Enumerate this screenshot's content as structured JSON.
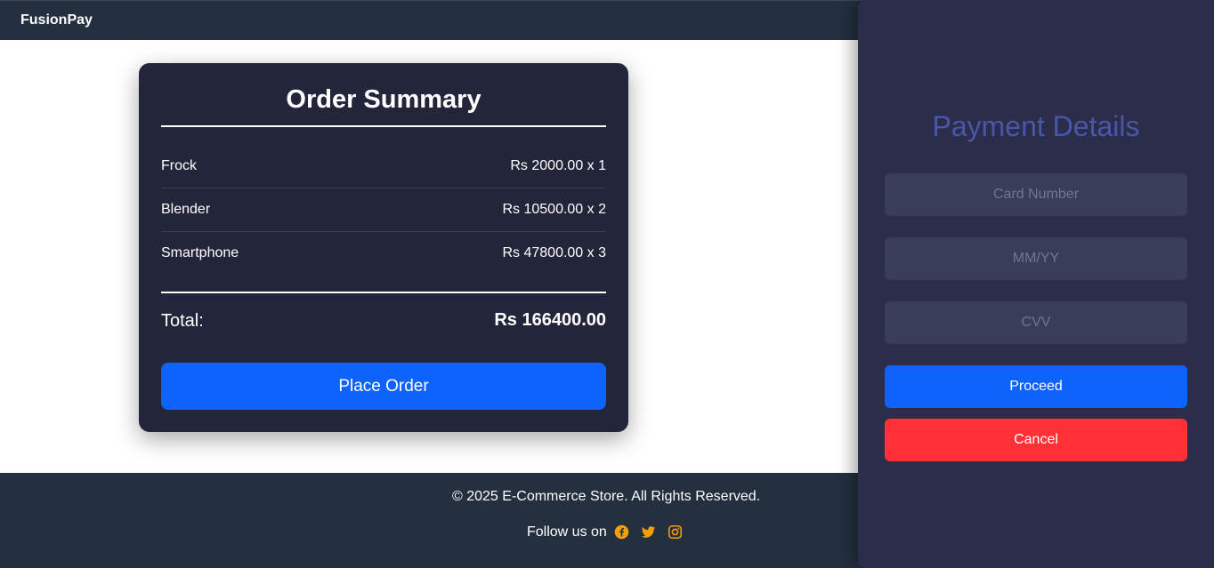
{
  "navbar": {
    "brand": "FusionPay"
  },
  "order": {
    "title": "Order Summary",
    "items": [
      {
        "name": "Frock",
        "price": "Rs 2000.00 x 1"
      },
      {
        "name": "Blender",
        "price": "Rs 10500.00 x 2"
      },
      {
        "name": "Smartphone",
        "price": "Rs 47800.00 x 3"
      }
    ],
    "total_label": "Total:",
    "total_value": "Rs 166400.00",
    "place_order_label": "Place Order"
  },
  "footer": {
    "copyright": "© 2025 E-Commerce Store. All Rights Reserved.",
    "follow_text": "Follow us on",
    "social_icons": [
      "facebook-icon",
      "twitter-icon",
      "instagram-icon"
    ],
    "icon_color": "#f59e0b"
  },
  "payment": {
    "title": "Payment Details",
    "card_number_placeholder": "Card Number",
    "expiry_placeholder": "MM/YY",
    "cvv_placeholder": "CVV",
    "proceed_label": "Proceed",
    "cancel_label": "Cancel"
  },
  "colors": {
    "accent_blue": "#0d63fb",
    "cancel_red": "#ff3136",
    "title_purple": "#4a57a8"
  }
}
